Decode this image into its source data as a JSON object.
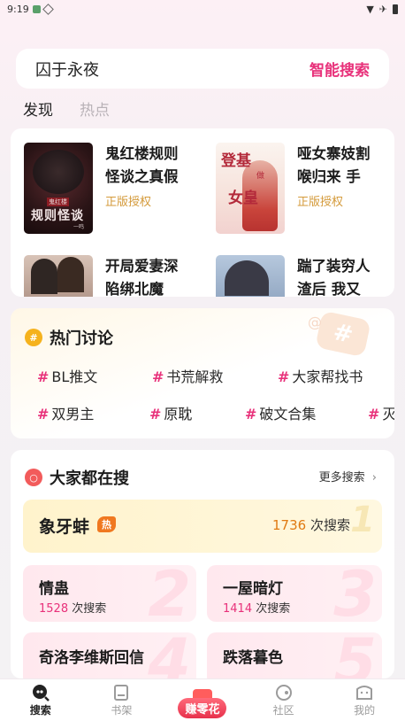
{
  "status_bar": {
    "time": "9:19"
  },
  "search": {
    "query": "囚于永夜",
    "smart_label": "智能搜索"
  },
  "tabs": [
    {
      "label": "发现"
    },
    {
      "label": "热点"
    }
  ],
  "discover": {
    "books": [
      {
        "title": "鬼红楼规则怪谈之真假",
        "tag": "正版授权",
        "cover_text_small": "鬼红楼",
        "cover_text": "规则怪谈",
        "cover_author": "一鸣"
      },
      {
        "title": "哑女寨妓割喉归来 手",
        "tag": "正版授权",
        "cover_text_1": "登基",
        "cover_text_2": "女皇",
        "cover_text_small": "做"
      },
      {
        "title": "开局爱妻深陷绑北魔"
      },
      {
        "title": "踹了装穷人渣后 我又"
      }
    ]
  },
  "hot_topics": {
    "title": "热门讨论",
    "topics": [
      "BL推文",
      "书荒解救",
      "大家帮找书",
      "双男主",
      "原耽",
      "破文合集",
      "灭"
    ]
  },
  "popular": {
    "title": "大家都在搜",
    "more_label": "更多搜索",
    "items": [
      {
        "rank": "1",
        "name": "象牙蚌",
        "badge": "热",
        "count": "1736",
        "unit": "次搜索"
      },
      {
        "rank": "2",
        "name": "情蛊",
        "count": "1528",
        "unit": "次搜索"
      },
      {
        "rank": "3",
        "name": "一屋暗灯",
        "count": "1414",
        "unit": "次搜索"
      },
      {
        "rank": "4",
        "name": "奇洛李维斯回信"
      },
      {
        "rank": "5",
        "name": "跌落暮色"
      }
    ]
  },
  "bottom_nav": {
    "items": [
      {
        "label": "搜索"
      },
      {
        "label": "书架"
      },
      {
        "label": "赚零花"
      },
      {
        "label": "社区"
      },
      {
        "label": "我的"
      }
    ]
  },
  "colors": {
    "accent": "#e8317a",
    "tag": "#d49a3a",
    "hot": "#f07820"
  }
}
